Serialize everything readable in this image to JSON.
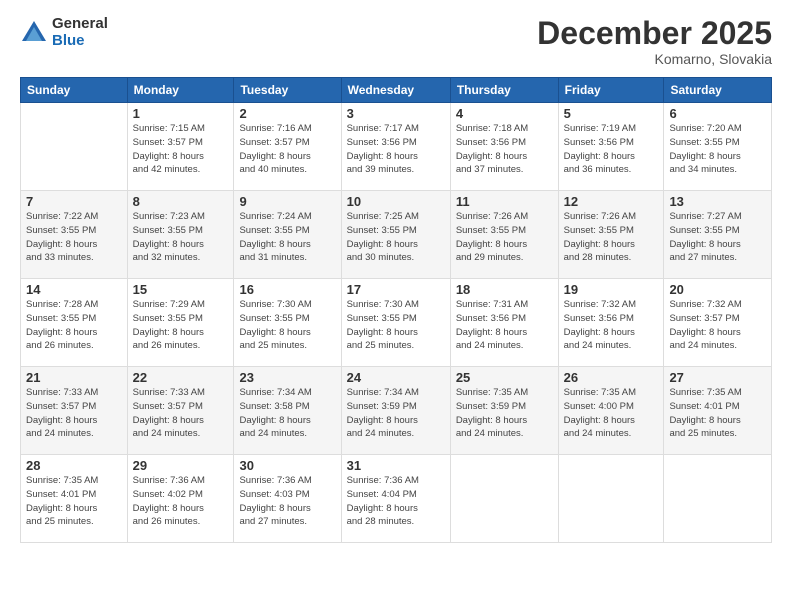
{
  "logo": {
    "general": "General",
    "blue": "Blue"
  },
  "title": "December 2025",
  "location": "Komarno, Slovakia",
  "weekdays": [
    "Sunday",
    "Monday",
    "Tuesday",
    "Wednesday",
    "Thursday",
    "Friday",
    "Saturday"
  ],
  "weeks": [
    [
      {
        "day": "",
        "info": ""
      },
      {
        "day": "1",
        "info": "Sunrise: 7:15 AM\nSunset: 3:57 PM\nDaylight: 8 hours\nand 42 minutes."
      },
      {
        "day": "2",
        "info": "Sunrise: 7:16 AM\nSunset: 3:57 PM\nDaylight: 8 hours\nand 40 minutes."
      },
      {
        "day": "3",
        "info": "Sunrise: 7:17 AM\nSunset: 3:56 PM\nDaylight: 8 hours\nand 39 minutes."
      },
      {
        "day": "4",
        "info": "Sunrise: 7:18 AM\nSunset: 3:56 PM\nDaylight: 8 hours\nand 37 minutes."
      },
      {
        "day": "5",
        "info": "Sunrise: 7:19 AM\nSunset: 3:56 PM\nDaylight: 8 hours\nand 36 minutes."
      },
      {
        "day": "6",
        "info": "Sunrise: 7:20 AM\nSunset: 3:55 PM\nDaylight: 8 hours\nand 34 minutes."
      }
    ],
    [
      {
        "day": "7",
        "info": "Sunrise: 7:22 AM\nSunset: 3:55 PM\nDaylight: 8 hours\nand 33 minutes."
      },
      {
        "day": "8",
        "info": "Sunrise: 7:23 AM\nSunset: 3:55 PM\nDaylight: 8 hours\nand 32 minutes."
      },
      {
        "day": "9",
        "info": "Sunrise: 7:24 AM\nSunset: 3:55 PM\nDaylight: 8 hours\nand 31 minutes."
      },
      {
        "day": "10",
        "info": "Sunrise: 7:25 AM\nSunset: 3:55 PM\nDaylight: 8 hours\nand 30 minutes."
      },
      {
        "day": "11",
        "info": "Sunrise: 7:26 AM\nSunset: 3:55 PM\nDaylight: 8 hours\nand 29 minutes."
      },
      {
        "day": "12",
        "info": "Sunrise: 7:26 AM\nSunset: 3:55 PM\nDaylight: 8 hours\nand 28 minutes."
      },
      {
        "day": "13",
        "info": "Sunrise: 7:27 AM\nSunset: 3:55 PM\nDaylight: 8 hours\nand 27 minutes."
      }
    ],
    [
      {
        "day": "14",
        "info": "Sunrise: 7:28 AM\nSunset: 3:55 PM\nDaylight: 8 hours\nand 26 minutes."
      },
      {
        "day": "15",
        "info": "Sunrise: 7:29 AM\nSunset: 3:55 PM\nDaylight: 8 hours\nand 26 minutes."
      },
      {
        "day": "16",
        "info": "Sunrise: 7:30 AM\nSunset: 3:55 PM\nDaylight: 8 hours\nand 25 minutes."
      },
      {
        "day": "17",
        "info": "Sunrise: 7:30 AM\nSunset: 3:55 PM\nDaylight: 8 hours\nand 25 minutes."
      },
      {
        "day": "18",
        "info": "Sunrise: 7:31 AM\nSunset: 3:56 PM\nDaylight: 8 hours\nand 24 minutes."
      },
      {
        "day": "19",
        "info": "Sunrise: 7:32 AM\nSunset: 3:56 PM\nDaylight: 8 hours\nand 24 minutes."
      },
      {
        "day": "20",
        "info": "Sunrise: 7:32 AM\nSunset: 3:57 PM\nDaylight: 8 hours\nand 24 minutes."
      }
    ],
    [
      {
        "day": "21",
        "info": "Sunrise: 7:33 AM\nSunset: 3:57 PM\nDaylight: 8 hours\nand 24 minutes."
      },
      {
        "day": "22",
        "info": "Sunrise: 7:33 AM\nSunset: 3:57 PM\nDaylight: 8 hours\nand 24 minutes."
      },
      {
        "day": "23",
        "info": "Sunrise: 7:34 AM\nSunset: 3:58 PM\nDaylight: 8 hours\nand 24 minutes."
      },
      {
        "day": "24",
        "info": "Sunrise: 7:34 AM\nSunset: 3:59 PM\nDaylight: 8 hours\nand 24 minutes."
      },
      {
        "day": "25",
        "info": "Sunrise: 7:35 AM\nSunset: 3:59 PM\nDaylight: 8 hours\nand 24 minutes."
      },
      {
        "day": "26",
        "info": "Sunrise: 7:35 AM\nSunset: 4:00 PM\nDaylight: 8 hours\nand 24 minutes."
      },
      {
        "day": "27",
        "info": "Sunrise: 7:35 AM\nSunset: 4:01 PM\nDaylight: 8 hours\nand 25 minutes."
      }
    ],
    [
      {
        "day": "28",
        "info": "Sunrise: 7:35 AM\nSunset: 4:01 PM\nDaylight: 8 hours\nand 25 minutes."
      },
      {
        "day": "29",
        "info": "Sunrise: 7:36 AM\nSunset: 4:02 PM\nDaylight: 8 hours\nand 26 minutes."
      },
      {
        "day": "30",
        "info": "Sunrise: 7:36 AM\nSunset: 4:03 PM\nDaylight: 8 hours\nand 27 minutes."
      },
      {
        "day": "31",
        "info": "Sunrise: 7:36 AM\nSunset: 4:04 PM\nDaylight: 8 hours\nand 28 minutes."
      },
      {
        "day": "",
        "info": ""
      },
      {
        "day": "",
        "info": ""
      },
      {
        "day": "",
        "info": ""
      }
    ]
  ]
}
